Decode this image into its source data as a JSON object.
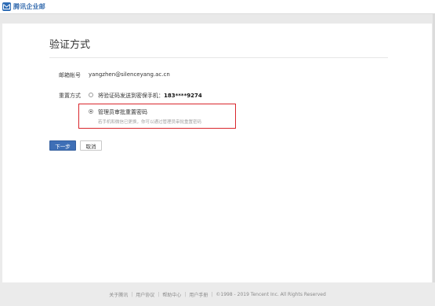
{
  "header": {
    "brand": "腾讯企业邮"
  },
  "page": {
    "title": "验证方式"
  },
  "form": {
    "email_label": "邮箱帐号",
    "email_value": "yangzhen@silenceyang.ac.cn",
    "reset_label": "重置方式",
    "option1_text": "将验证码发送到密保手机：",
    "option1_phone": "183****9274",
    "option2_text": "管理员审批重置密码",
    "option2_hint": "若手机和微信已更换，你可以通过管理员审批重置密码",
    "next_button": "下一步",
    "cancel_button": "取消"
  },
  "footer": {
    "link1": "关于腾讯",
    "link2": "用户协议",
    "link3": "帮助中心",
    "link4": "用户手册",
    "copyright": "©1998 - 2019 Tencent Inc. All Rights Reserved"
  },
  "colors": {
    "accent": "#3e6fb6",
    "highlight_border": "#d9262c"
  }
}
